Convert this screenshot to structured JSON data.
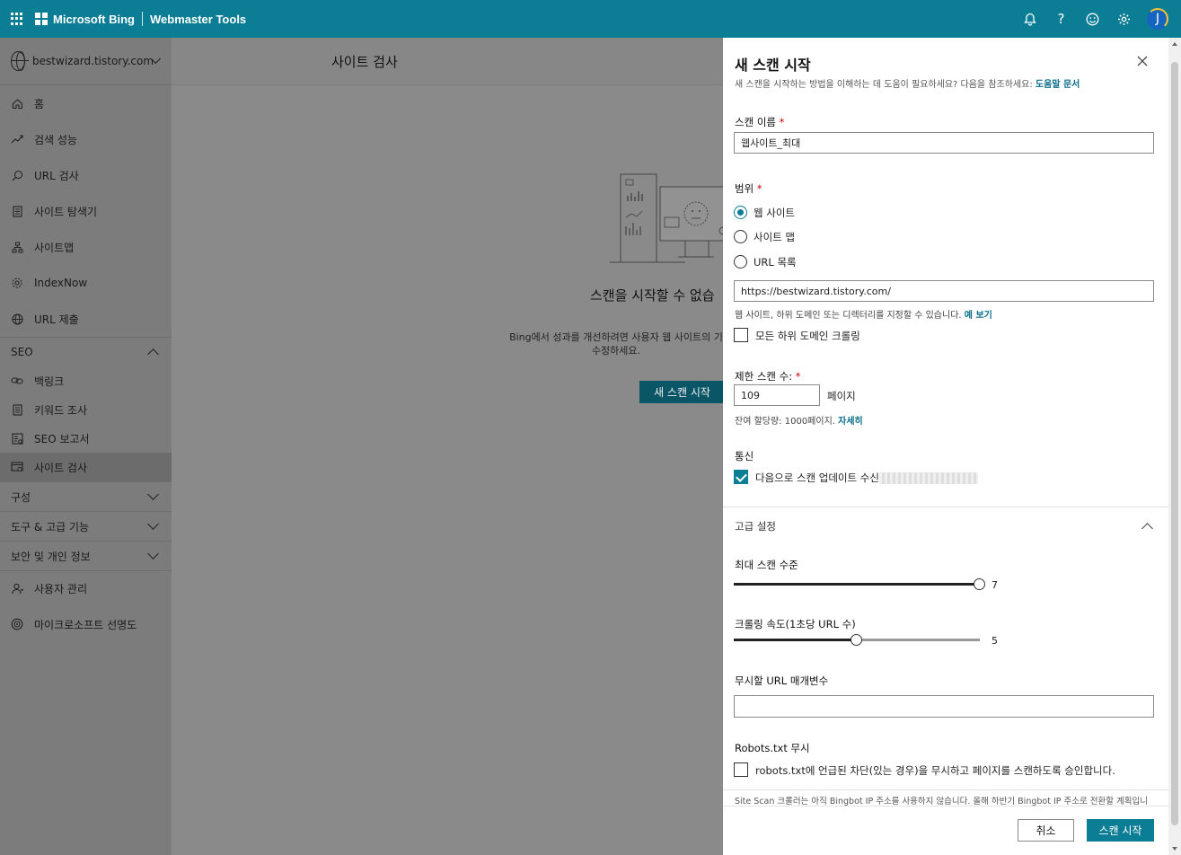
{
  "header": {
    "brand": "Microsoft Bing",
    "product": "Webmaster Tools",
    "avatar_initial": "J",
    "accent_color": "#0b7d95"
  },
  "sidebar": {
    "site": "bestwizard.tistory.com",
    "items": [
      {
        "label": "홈",
        "icon": "home-icon"
      },
      {
        "label": "검색 성능",
        "icon": "trend-icon"
      },
      {
        "label": "URL 검사",
        "icon": "search-icon"
      },
      {
        "label": "사이트 탐색기",
        "icon": "document-icon"
      },
      {
        "label": "사이트맵",
        "icon": "sitemap-icon"
      },
      {
        "label": "IndexNow",
        "icon": "gear-icon"
      },
      {
        "label": "URL 제출",
        "icon": "globe-icon"
      }
    ],
    "seo_section": "SEO",
    "seo_items": [
      {
        "label": "백링크",
        "icon": "link-icon"
      },
      {
        "label": "키워드 조사",
        "icon": "document-icon"
      },
      {
        "label": "SEO 보고서",
        "icon": "report-icon"
      },
      {
        "label": "사이트 검사",
        "icon": "scan-icon"
      }
    ],
    "sections": [
      "구성",
      "도구 & 고급 기능",
      "보안 및 개인 정보"
    ],
    "bottom_items": [
      {
        "label": "사용자 관리",
        "icon": "user-icon"
      },
      {
        "label": "마이크로소프트 선명도",
        "icon": "clarity-icon"
      }
    ]
  },
  "main": {
    "title": "사이트 검사",
    "empty_title": "스캔을 시작할 수 없습",
    "empty_desc_line1": "Bing에서 성과를 개선하려면 사용자 웹 사이트의 기",
    "empty_desc_line2": "수정하세요.",
    "start_button": "새 스캔 시작"
  },
  "panel": {
    "title": "새 스캔 시작",
    "help_text": "새 스캔을 시작하는 방법을 이해하는 데 도움이 필요하세요? 다음을 참조하세요: ",
    "help_link": "도움말 문서",
    "scan_name_label": "스캔 이름",
    "scan_name_value": "웹사이트_최대",
    "scope_label": "범위",
    "scope_options": [
      "웹 사이트",
      "사이트 맵",
      "URL 목록"
    ],
    "scope_selected": "웹 사이트",
    "url_value": "https://bestwizard.tistory.com/",
    "url_hint": "웹 사이트, 하위 도메인 또는 디렉터리를 지정할 수 있습니다. ",
    "url_hint_link": "예 보기",
    "subdomain_label": "모든 하위 도메인 크롤링",
    "limit_label": "제한 스캔 수:",
    "limit_value": "109",
    "limit_unit": "페이지",
    "quota_text": "잔여 할당량: 1000페이지. ",
    "quota_link": "자세히",
    "comm_label": "통신",
    "comm_checkbox": "다음으로 스캔 업데이트 수신",
    "advanced_label": "고급 설정",
    "max_level_label": "최대 스캔 수준",
    "max_level_value": "7",
    "max_level_fraction": 1.0,
    "crawl_speed_label": "크롤링 속도(1초당 URL 수)",
    "crawl_speed_value": "5",
    "crawl_speed_fraction": 0.5,
    "ignore_params_label": "무시할 URL 매개변수",
    "ignore_params_value": "",
    "robots_label": "Robots.txt 무시",
    "robots_checkbox": "robots.txt에 언급된 차단(있는 경우)을 무시하고 페이지를 스캔하도록 승인합니다.",
    "footer_note": "Site Scan 크롤러는 아직 Bingbot IP 주소를 사용하지 않습니다. 올해 하반기 Bingbot IP 주소로 전환할 계획입니",
    "cancel_button": "취소",
    "submit_button": "스캔 시작"
  }
}
